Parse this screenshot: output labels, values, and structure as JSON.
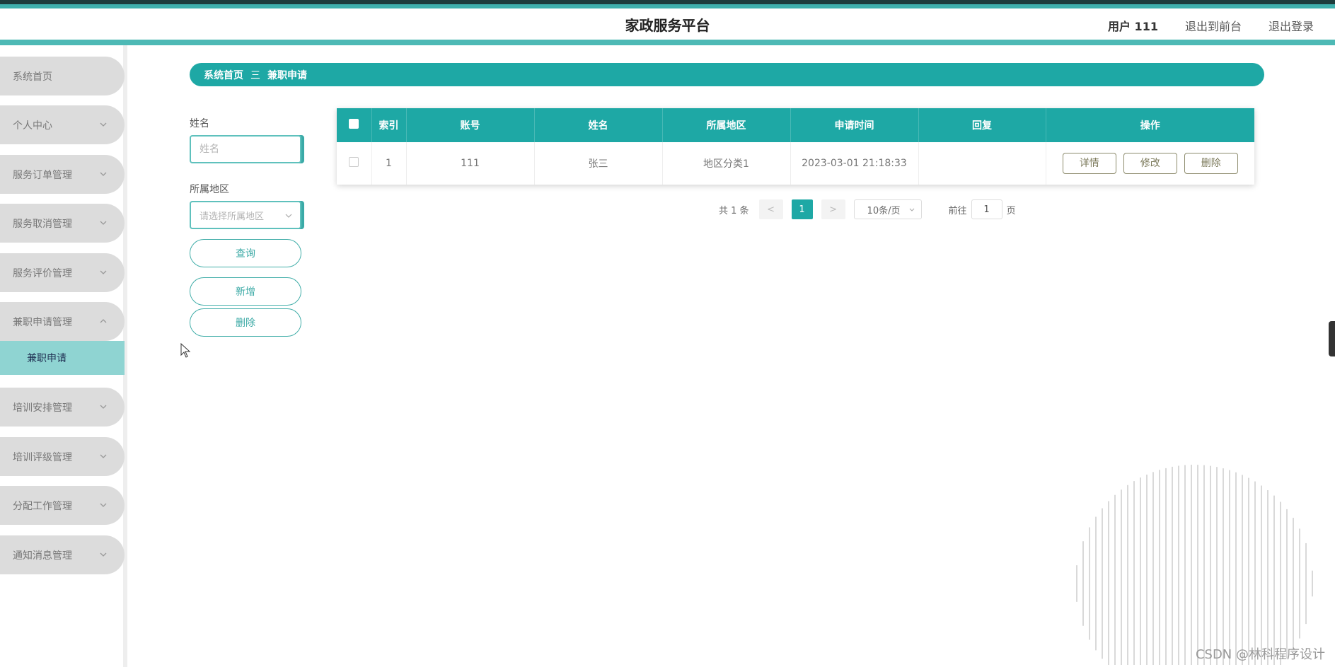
{
  "header": {
    "title": "家政服务平台",
    "user": "用户 111",
    "to_front": "退出到前台",
    "logout": "退出登录"
  },
  "sidebar": {
    "items": [
      {
        "label": "系统首页"
      },
      {
        "label": "个人中心"
      },
      {
        "label": "服务订单管理"
      },
      {
        "label": "服务取消管理"
      },
      {
        "label": "服务评价管理"
      },
      {
        "label": "兼职申请管理"
      },
      {
        "label": "培训安排管理"
      },
      {
        "label": "培训评级管理"
      },
      {
        "label": "分配工作管理"
      },
      {
        "label": "通知消息管理"
      }
    ],
    "active_sub": "兼职申请"
  },
  "breadcrumb": {
    "home": "系统首页",
    "separator": "三",
    "current": "兼职申请"
  },
  "search": {
    "name_label": "姓名",
    "name_placeholder": "姓名",
    "region_label": "所属地区",
    "region_placeholder": "请选择所属地区",
    "query_button": "查询",
    "add_button": "新增",
    "delete_button": "删除"
  },
  "table": {
    "columns": [
      "索引",
      "账号",
      "姓名",
      "所属地区",
      "申请时间",
      "回复",
      "操作"
    ],
    "rows": [
      {
        "index": "1",
        "account": "111",
        "name": "张三",
        "region": "地区分类1",
        "time": "2023-03-01 21:18:33",
        "reply": ""
      }
    ],
    "actions": {
      "detail": "详情",
      "edit": "修改",
      "delete": "删除"
    }
  },
  "pager": {
    "total": "共 1 条",
    "prev": "<",
    "current": "1",
    "next": ">",
    "page_size": "10条/页",
    "goto_prefix": "前往",
    "goto_value": "1",
    "goto_suffix": "页"
  },
  "watermark": "CSDN @林科程序设计",
  "colors": {
    "accent": "#1ea8a5",
    "header_bar": "#4db9b5",
    "menu_bg": "#dcdcdc",
    "active_sub": "#8fd4d2"
  }
}
